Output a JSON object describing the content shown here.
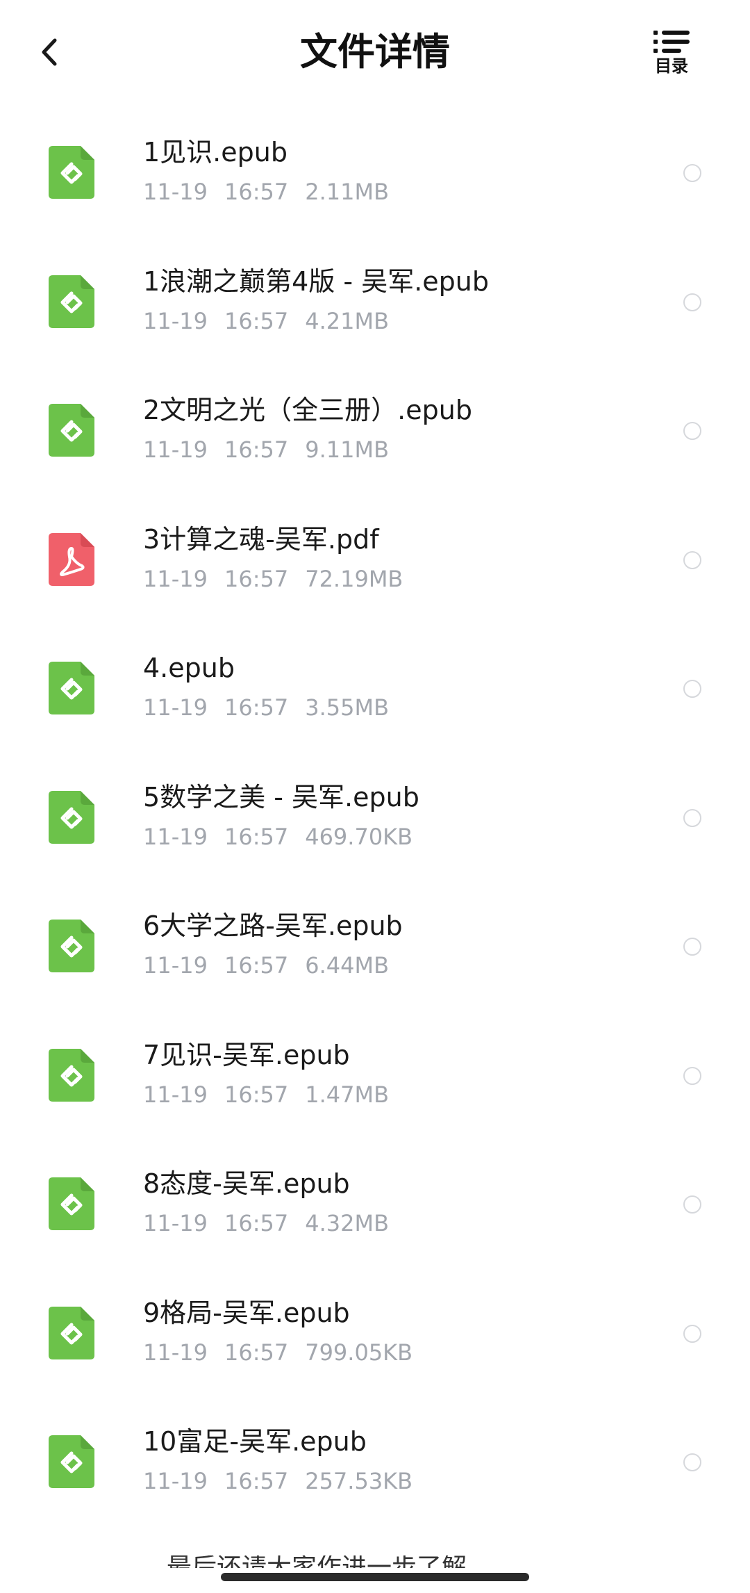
{
  "header": {
    "title": "文件详情",
    "toc_label": "目录"
  },
  "files": [
    {
      "name": "1见识.epub",
      "date": "11-19",
      "time": "16:57",
      "size": "2.11MB",
      "type": "epub"
    },
    {
      "name": "1浪潮之巅第4版 - 吴军.epub",
      "date": "11-19",
      "time": "16:57",
      "size": "4.21MB",
      "type": "epub"
    },
    {
      "name": "2文明之光（全三册）.epub",
      "date": "11-19",
      "time": "16:57",
      "size": "9.11MB",
      "type": "epub"
    },
    {
      "name": "3计算之魂-吴军.pdf",
      "date": "11-19",
      "time": "16:57",
      "size": "72.19MB",
      "type": "pdf"
    },
    {
      "name": "4.epub",
      "date": "11-19",
      "time": "16:57",
      "size": "3.55MB",
      "type": "epub"
    },
    {
      "name": "5数学之美 - 吴军.epub",
      "date": "11-19",
      "time": "16:57",
      "size": "469.70KB",
      "type": "epub"
    },
    {
      "name": "6大学之路-吴军.epub",
      "date": "11-19",
      "time": "16:57",
      "size": "6.44MB",
      "type": "epub"
    },
    {
      "name": "7见识-吴军.epub",
      "date": "11-19",
      "time": "16:57",
      "size": "1.47MB",
      "type": "epub"
    },
    {
      "name": "8态度-吴军.epub",
      "date": "11-19",
      "time": "16:57",
      "size": "4.32MB",
      "type": "epub"
    },
    {
      "name": "9格局-吴军.epub",
      "date": "11-19",
      "time": "16:57",
      "size": "799.05KB",
      "type": "epub"
    },
    {
      "name": "10富足-吴军.epub",
      "date": "11-19",
      "time": "16:57",
      "size": "257.53KB",
      "type": "epub"
    }
  ],
  "footer": {
    "partial_text": "最后还请大家作进一步了解"
  },
  "colors": {
    "epub_icon": "#6cc24a",
    "pdf_icon": "#f0606a",
    "meta_text": "#a2a6ad",
    "radio_border": "#d6d8dc"
  },
  "icons": {
    "back": "chevron-left-icon",
    "toc": "list-icon",
    "epub": "epub-file-icon",
    "pdf": "pdf-file-icon"
  }
}
